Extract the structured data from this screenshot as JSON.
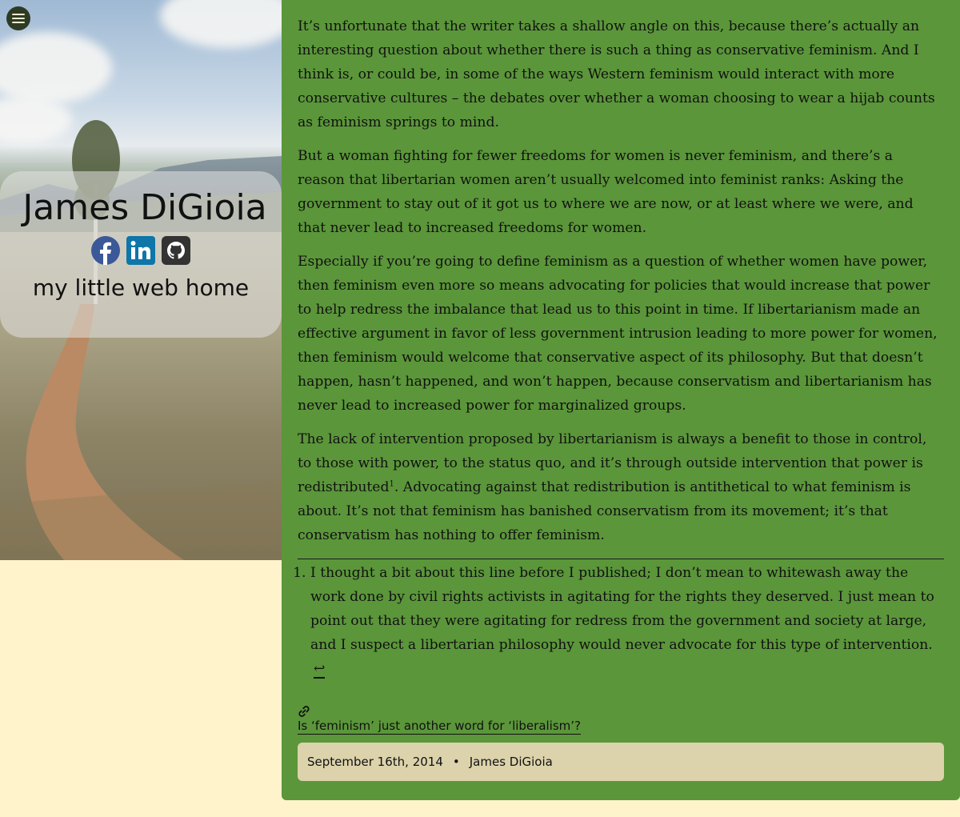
{
  "site": {
    "title": "James DiGioia",
    "tagline": "my little web home",
    "social": [
      {
        "name": "facebook",
        "icon": "facebook-icon",
        "color": "#3b5998"
      },
      {
        "name": "linkedin",
        "icon": "linkedin-icon",
        "color": "#0e76a8"
      },
      {
        "name": "github",
        "icon": "github-icon",
        "color": "#333333"
      }
    ],
    "menu_icon": "hamburger-menu-icon"
  },
  "article": {
    "paragraphs": [
      "It’s unfortunate that the writer takes a shallow angle on this, because there’s actually an interesting question about whether there is such a thing as conservative feminism. And I think is, or could be, in some of the ways Western feminism would interact with more conservative cultures – the debates over whether a woman choosing to wear a hijab counts as feminism springs to mind.",
      "But a woman fighting for fewer freedoms for women is never feminism, and there’s a reason that libertarian women aren’t usually welcomed into feminist ranks: Asking the government to stay out of it got us to where we are now, or at least where we were, and that never lead to increased freedoms for women.",
      "Especially if you’re going to define feminism as a question of whether women have power, then feminism even more so means advocating for policies that would increase that power to help redress the imbalance that lead us to this point in time. If libertarianism made an effective argument in favor of less government intrusion leading to more power for women, then feminism would welcome that conservative aspect of its philosophy. But that doesn’t happen, hasn’t happened, and won’t happen, because conservatism and libertarianism has never lead to increased power for marginalized groups."
    ],
    "p4_before": "The lack of intervention proposed by libertarianism is always a benefit to those in control, to those with power, to the status quo, and it’s through outside intervention that power is redistributed",
    "footnote_ref": "1",
    "p4_after": ". Advocating against that redistribution is antithetical to what feminism is about. It’s not that feminism has banished conservatism from its movement; it’s that conservatism has nothing to offer feminism.",
    "footnotes": [
      {
        "text": "I thought a bit about this line before I published; I don’t mean to whitewash away the work done by civil rights activists in agitating for the rights they deserved. I just mean to point out that they were agitating for redress from the government and society at large, and I suspect a libertarian philosophy would never advocate for this type of intervention.",
        "backref": "↩"
      }
    ],
    "permalink_icon": "link-icon",
    "link_title": "Is ‘feminism’ just another word for ‘liberalism’?",
    "date": "September 16th, 2014",
    "separator": "•",
    "author": "James DiGioia"
  },
  "colors": {
    "article_bg": "#5b963a",
    "page_bg": "#fff3cc",
    "meta_bg": "#dcd2ab"
  }
}
